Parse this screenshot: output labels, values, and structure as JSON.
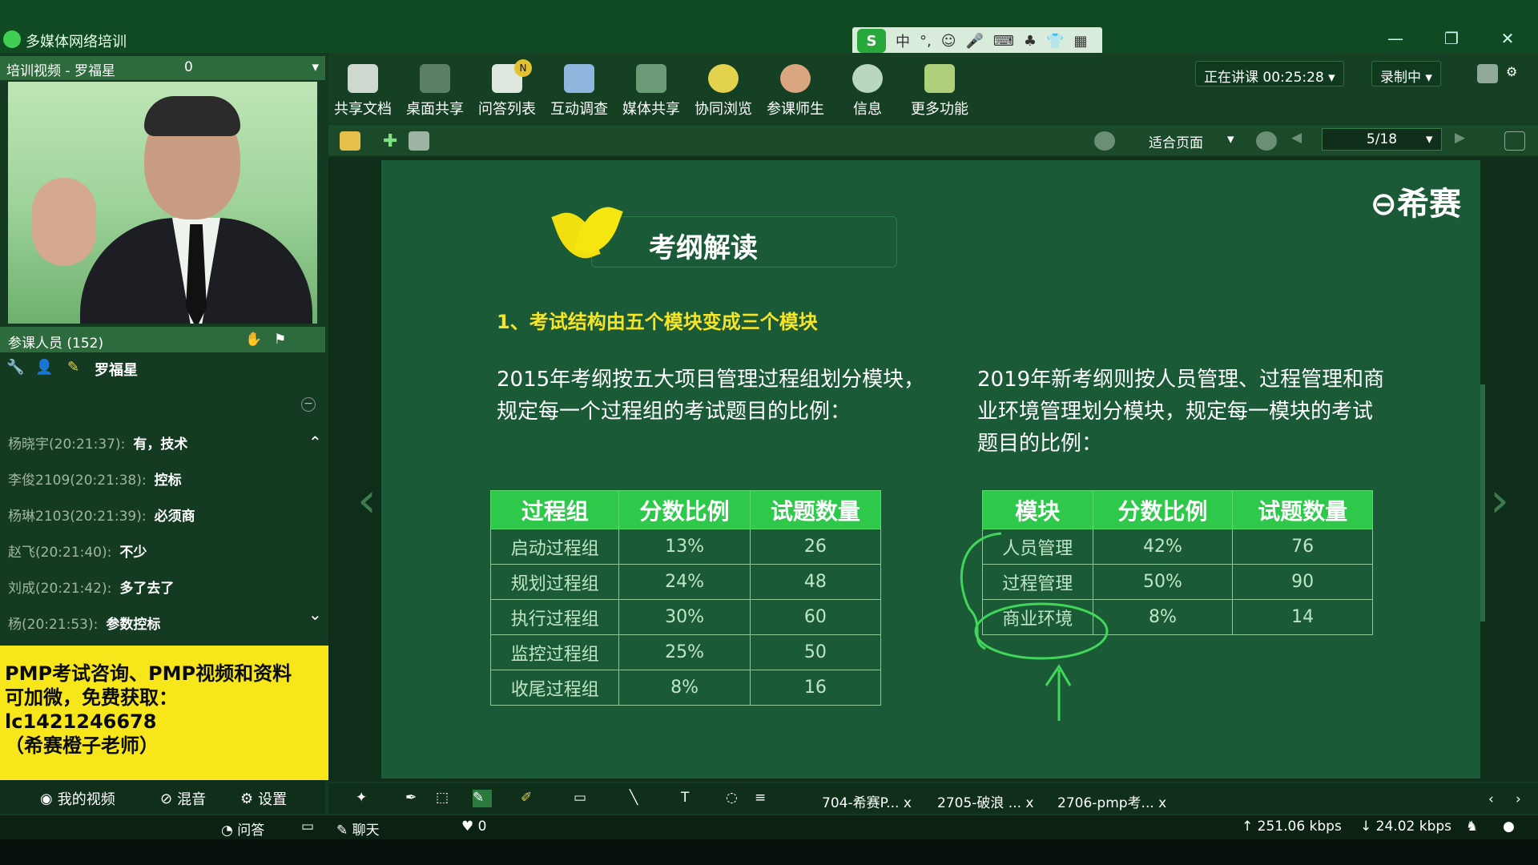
{
  "window": {
    "title": "多媒体网络培训"
  },
  "video_panel": {
    "header": "培训视频 - 罗福星",
    "count": "0"
  },
  "participants": {
    "label": "参课人员 (152)",
    "presenter": "罗福星"
  },
  "chat": {
    "messages": [
      {
        "who": "杨晓宇(20:21:37):",
        "text": "有，技术"
      },
      {
        "who": "李俊2109(20:21:38):",
        "text": "控标"
      },
      {
        "who": "杨琳2103(20:21:39):",
        "text": "必须商"
      },
      {
        "who": "赵飞(20:21:40):",
        "text": "不少"
      },
      {
        "who": "刘成(20:21:42):",
        "text": "多了去了"
      },
      {
        "who": "杨(20:21:53):",
        "text": "参数控标"
      }
    ]
  },
  "ad": {
    "line1": "PMP考试咨询、PMP视频和资料",
    "line2": "可加微，免费获取：",
    "line3": "lc1421246678",
    "line4": "（希赛橙子老师）"
  },
  "left_bottom": {
    "my_video": "我的视频",
    "mix": "混音",
    "settings": "设置"
  },
  "toolbar": {
    "items": [
      {
        "label": "共享文档",
        "icon": "document-icon"
      },
      {
        "label": "桌面共享",
        "icon": "desktop-share-icon"
      },
      {
        "label": "问答列表",
        "icon": "qa-list-icon",
        "badge": "N"
      },
      {
        "label": "互动调查",
        "icon": "survey-icon"
      },
      {
        "label": "媒体共享",
        "icon": "media-share-icon"
      },
      {
        "label": "协同浏览",
        "icon": "browse-icon"
      },
      {
        "label": "参课师生",
        "icon": "users-icon"
      },
      {
        "label": "信息",
        "icon": "info-icon"
      },
      {
        "label": "更多功能",
        "icon": "more-icon"
      }
    ],
    "status": "正在讲课 00:25:28",
    "recording": "录制中"
  },
  "subtoolbar": {
    "fit": "适合页面",
    "page": "5/18"
  },
  "slide": {
    "logo": "希赛",
    "title": "考纲解读",
    "point": "1、考试结构由五个模块变成三个模块",
    "left_para": [
      "2015年考纲按五大项目管理过程组划分模块，",
      "规定每一个过程组的考试题目的比例："
    ],
    "right_para": [
      "2019年新考纲则按人员管理、过程管理和商",
      "业环境管理划分模块，规定每一模块的考试",
      "题目的比例："
    ],
    "left_table": {
      "headers": [
        "过程组",
        "分数比例",
        "试题数量"
      ],
      "rows": [
        [
          "启动过程组",
          "13%",
          "26"
        ],
        [
          "规划过程组",
          "24%",
          "48"
        ],
        [
          "执行过程组",
          "30%",
          "60"
        ],
        [
          "监控过程组",
          "25%",
          "50"
        ],
        [
          "收尾过程组",
          "8%",
          "16"
        ]
      ]
    },
    "right_table": {
      "headers": [
        "模块",
        "分数比例",
        "试题数量"
      ],
      "rows": [
        [
          "人员管理",
          "42%",
          "76"
        ],
        [
          "过程管理",
          "50%",
          "90"
        ],
        [
          "商业环境",
          "8%",
          "14"
        ]
      ]
    }
  },
  "bottom_tabs": [
    "704-希赛P...",
    "2705-破浪 ...",
    "2706-pmp考..."
  ],
  "status": {
    "qa": "问答",
    "chat": "聊天",
    "likes": "0",
    "up": "251.06 kbps",
    "down": "24.02 kbps"
  },
  "colors": {
    "table_header": "#2ec94a",
    "slide_bg": "#1b5a36",
    "accent_yellow": "#f6e426"
  }
}
